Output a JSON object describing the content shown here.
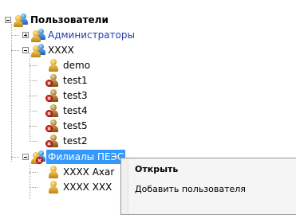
{
  "tree": {
    "root_label": "Пользователи",
    "groups": [
      {
        "label": "Администраторы",
        "expanded": false
      },
      {
        "label": "XXXX",
        "expanded": true,
        "users": [
          {
            "label": "demo",
            "disabled": false
          },
          {
            "label": "test1",
            "disabled": true
          },
          {
            "label": "test3",
            "disabled": true
          },
          {
            "label": "test4",
            "disabled": true
          },
          {
            "label": "test5",
            "disabled": true
          },
          {
            "label": "test2",
            "disabled": true
          }
        ]
      },
      {
        "label": "Филиалы ПЕЭС",
        "expanded": true,
        "selected": true,
        "users": [
          {
            "label": "XXXX Axar"
          },
          {
            "label": "XXXX XXX"
          }
        ]
      }
    ]
  },
  "context_menu": {
    "items": [
      {
        "label": "Открыть",
        "default": true
      },
      {
        "label": "Добавить пользователя",
        "default": false
      }
    ]
  }
}
